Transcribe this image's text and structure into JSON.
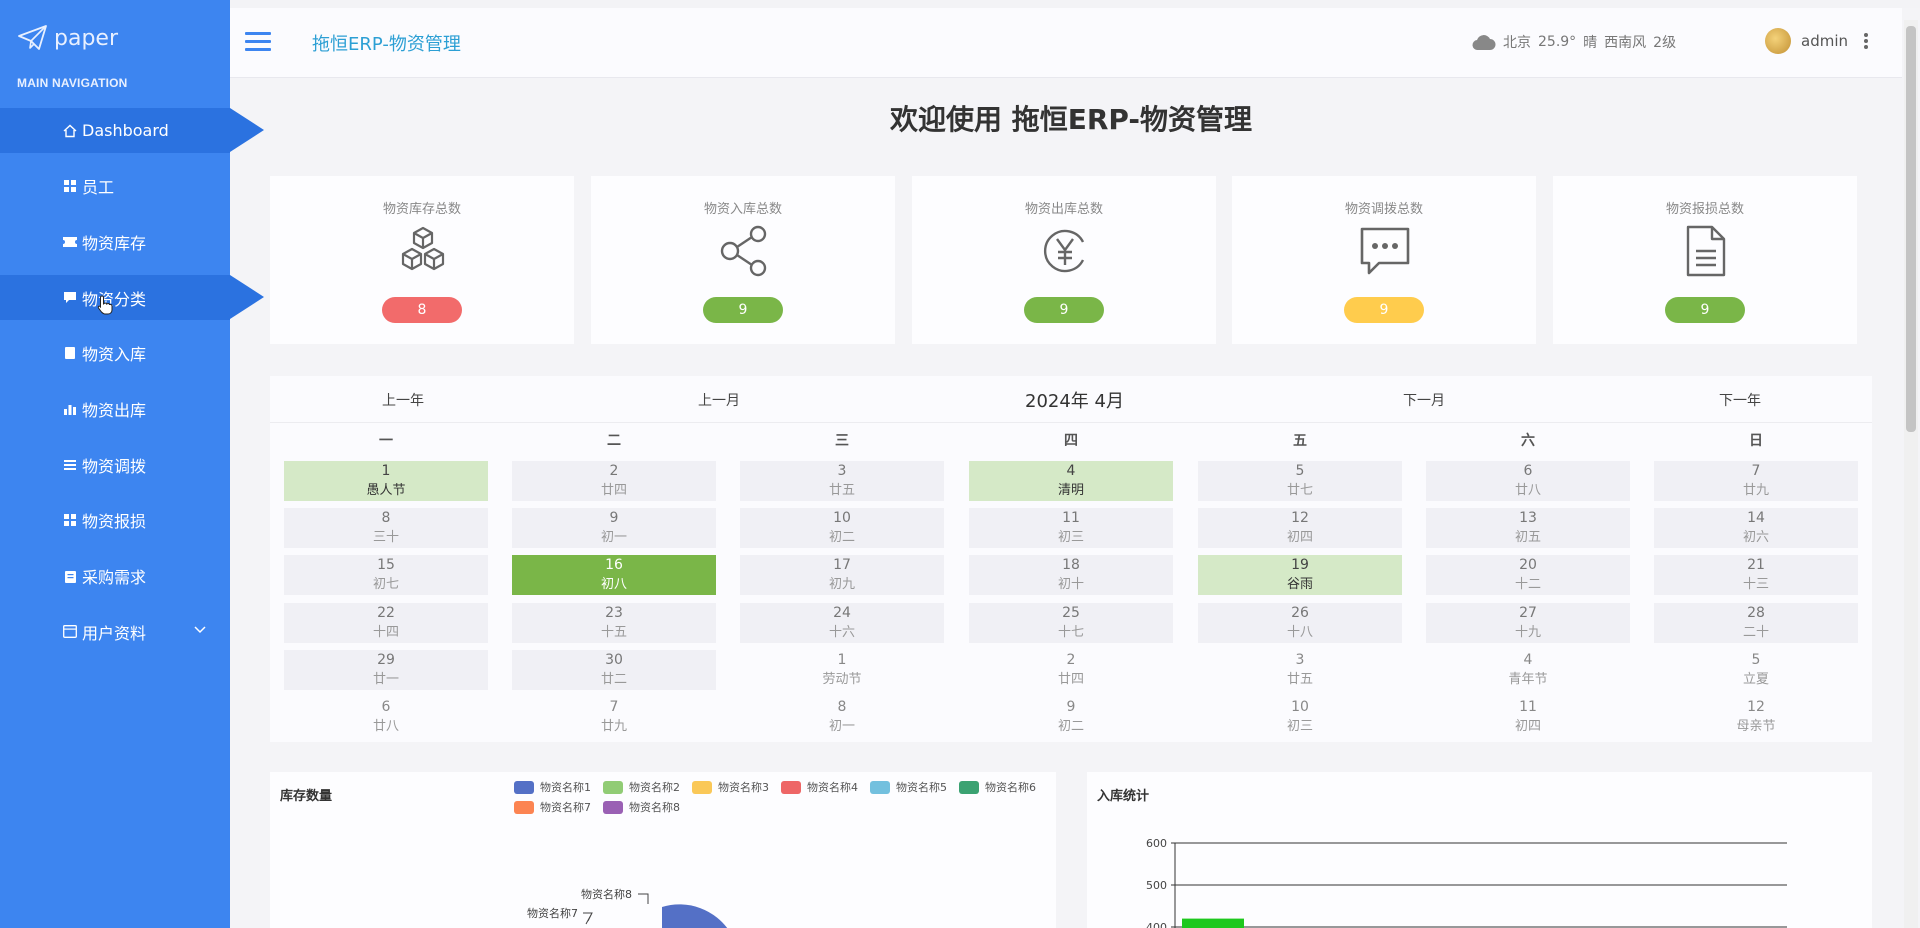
{
  "sidebar": {
    "logo_text": "paper",
    "nav_title": "MAIN NAVIGATION",
    "items": [
      {
        "label": "Dashboard",
        "icon": "home-icon"
      },
      {
        "label": "员工",
        "icon": "grid-icon"
      },
      {
        "label": "物资库存",
        "icon": "ticket-icon"
      },
      {
        "label": "物资分类",
        "icon": "comment-icon"
      },
      {
        "label": "物资入库",
        "icon": "doc-icon"
      },
      {
        "label": "物资出库",
        "icon": "bar-chart-icon"
      },
      {
        "label": "物资调拨",
        "icon": "list-icon"
      },
      {
        "label": "物资报损",
        "icon": "grid-icon"
      },
      {
        "label": "采购需求",
        "icon": "clipboard-icon"
      },
      {
        "label": "用户资料",
        "icon": "calendar-icon"
      }
    ]
  },
  "header": {
    "title": "拖恒ERP-物资管理",
    "weather": {
      "city": "北京",
      "temp": "25.9°",
      "condition": "晴",
      "wind": "西南风",
      "level": "2级"
    },
    "username": "admin"
  },
  "welcome": "欢迎使用 拖恒ERP-物资管理",
  "stats": [
    {
      "title": "物资库存总数",
      "value": "8",
      "color": "#f26b6b",
      "icon": "cubes-icon"
    },
    {
      "title": "物资入库总数",
      "value": "9",
      "color": "#7ab648",
      "icon": "share-icon"
    },
    {
      "title": "物资出库总数",
      "value": "9",
      "color": "#7ab648",
      "icon": "yen-icon"
    },
    {
      "title": "物资调拨总数",
      "value": "9",
      "color": "#ffcc4d",
      "icon": "message-icon"
    },
    {
      "title": "物资报损总数",
      "value": "9",
      "color": "#7ab648",
      "icon": "document-icon"
    }
  ],
  "calendar": {
    "prev_year": "上一年",
    "prev_month": "上一月",
    "current": "2024年 4月",
    "next_month": "下一月",
    "next_year": "下一年",
    "weekdays": [
      "一",
      "二",
      "三",
      "四",
      "五",
      "六",
      "日"
    ],
    "weeks": [
      [
        {
          "d": "1",
          "l": "愚人节",
          "t": "holiday"
        },
        {
          "d": "2",
          "l": "廿四",
          "t": "cur"
        },
        {
          "d": "3",
          "l": "廿五",
          "t": "cur"
        },
        {
          "d": "4",
          "l": "清明",
          "t": "holiday"
        },
        {
          "d": "5",
          "l": "廿七",
          "t": "cur"
        },
        {
          "d": "6",
          "l": "廿八",
          "t": "cur"
        },
        {
          "d": "7",
          "l": "廿九",
          "t": "cur"
        }
      ],
      [
        {
          "d": "8",
          "l": "三十",
          "t": "cur"
        },
        {
          "d": "9",
          "l": "初一",
          "t": "cur"
        },
        {
          "d": "10",
          "l": "初二",
          "t": "cur"
        },
        {
          "d": "11",
          "l": "初三",
          "t": "cur"
        },
        {
          "d": "12",
          "l": "初四",
          "t": "cur"
        },
        {
          "d": "13",
          "l": "初五",
          "t": "cur"
        },
        {
          "d": "14",
          "l": "初六",
          "t": "cur"
        }
      ],
      [
        {
          "d": "15",
          "l": "初七",
          "t": "cur"
        },
        {
          "d": "16",
          "l": "初八",
          "t": "today"
        },
        {
          "d": "17",
          "l": "初九",
          "t": "cur"
        },
        {
          "d": "18",
          "l": "初十",
          "t": "cur"
        },
        {
          "d": "19",
          "l": "谷雨",
          "t": "holiday"
        },
        {
          "d": "20",
          "l": "十二",
          "t": "cur"
        },
        {
          "d": "21",
          "l": "十三",
          "t": "cur"
        }
      ],
      [
        {
          "d": "22",
          "l": "十四",
          "t": "cur"
        },
        {
          "d": "23",
          "l": "十五",
          "t": "cur"
        },
        {
          "d": "24",
          "l": "十六",
          "t": "cur"
        },
        {
          "d": "25",
          "l": "十七",
          "t": "cur"
        },
        {
          "d": "26",
          "l": "十八",
          "t": "cur"
        },
        {
          "d": "27",
          "l": "十九",
          "t": "cur"
        },
        {
          "d": "28",
          "l": "二十",
          "t": "cur"
        }
      ],
      [
        {
          "d": "29",
          "l": "廿一",
          "t": "cur"
        },
        {
          "d": "30",
          "l": "廿二",
          "t": "cur"
        },
        {
          "d": "1",
          "l": "劳动节",
          "t": "other"
        },
        {
          "d": "2",
          "l": "廿四",
          "t": "other"
        },
        {
          "d": "3",
          "l": "廿五",
          "t": "other"
        },
        {
          "d": "4",
          "l": "青年节",
          "t": "other"
        },
        {
          "d": "5",
          "l": "立夏",
          "t": "other"
        }
      ],
      [
        {
          "d": "6",
          "l": "廿八",
          "t": "other"
        },
        {
          "d": "7",
          "l": "廿九",
          "t": "other"
        },
        {
          "d": "8",
          "l": "初一",
          "t": "other"
        },
        {
          "d": "9",
          "l": "初二",
          "t": "other"
        },
        {
          "d": "10",
          "l": "初三",
          "t": "other"
        },
        {
          "d": "11",
          "l": "初四",
          "t": "other"
        },
        {
          "d": "12",
          "l": "母亲节",
          "t": "other"
        }
      ]
    ]
  },
  "inventory_panel": {
    "title": "库存数量",
    "legend": [
      {
        "name": "物资名称1",
        "color": "#5470c6"
      },
      {
        "name": "物资名称2",
        "color": "#91cc75"
      },
      {
        "name": "物资名称3",
        "color": "#fac858"
      },
      {
        "name": "物资名称4",
        "color": "#ee6666"
      },
      {
        "name": "物资名称5",
        "color": "#73c0de"
      },
      {
        "name": "物资名称6",
        "color": "#3ba272"
      },
      {
        "name": "物资名称7",
        "color": "#fc8452"
      },
      {
        "name": "物资名称8",
        "color": "#9a60b4"
      }
    ],
    "visible_labels": [
      "物资名称8",
      "物资名称7"
    ]
  },
  "inbound_panel": {
    "title": "入库统计",
    "chart_data": {
      "type": "bar",
      "yticks": [
        "600",
        "500",
        "400"
      ],
      "ylim": [
        400,
        600
      ],
      "bar_color": "#1ec81e",
      "visible_bar_value": 420
    }
  }
}
